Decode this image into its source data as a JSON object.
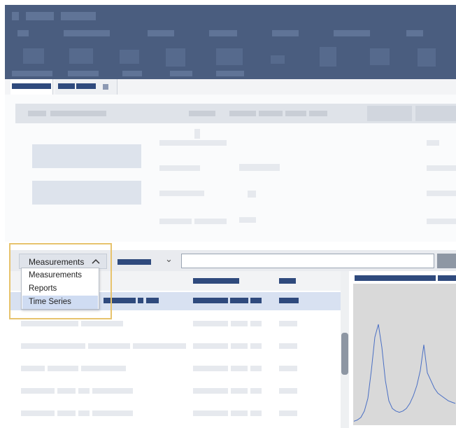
{
  "source_type": {
    "selected": "Measurements",
    "options": [
      "Measurements",
      "Reports",
      "Time Series"
    ],
    "highlighted_option": "Time Series",
    "expanded": true
  },
  "colors": {
    "ribbon": "#4a5d7f",
    "selection": "#d8e1f1",
    "highlight_outline": "#e7c36d",
    "spectrum_line": "#4a6fc4"
  },
  "icons": {
    "dropdown_chevron": "chevron-up-icon",
    "filter_chevron": "chevron-down-icon"
  },
  "spectrum": {
    "type": "line",
    "x": [
      0,
      5,
      10,
      15,
      20,
      25,
      30,
      35,
      40,
      45,
      50,
      55,
      60,
      65,
      70,
      75,
      80,
      85,
      90,
      95,
      100,
      105,
      110,
      115,
      120,
      125,
      130,
      135,
      140,
      145
    ],
    "y": [
      0.02,
      0.03,
      0.05,
      0.1,
      0.2,
      0.42,
      0.68,
      0.78,
      0.6,
      0.34,
      0.18,
      0.12,
      0.1,
      0.09,
      0.1,
      0.12,
      0.16,
      0.22,
      0.3,
      0.42,
      0.62,
      0.4,
      0.34,
      0.28,
      0.24,
      0.22,
      0.2,
      0.18,
      0.17,
      0.16
    ]
  }
}
